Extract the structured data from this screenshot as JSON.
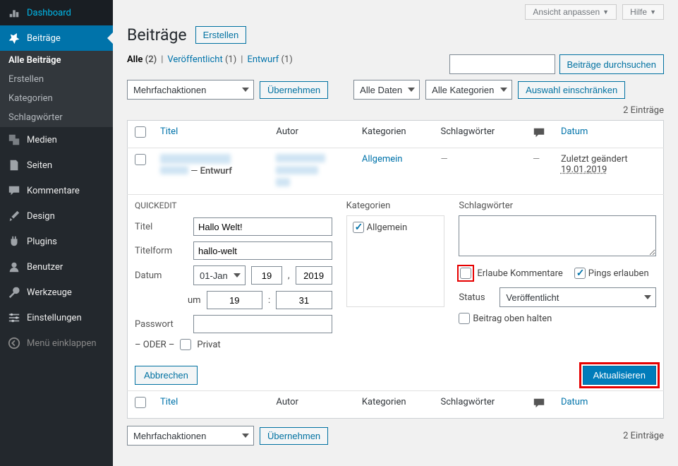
{
  "sidebar": {
    "items": [
      {
        "label": "Dashboard",
        "icon": "dashboard"
      },
      {
        "label": "Beiträge",
        "icon": "pin"
      },
      {
        "label": "Medien",
        "icon": "media"
      },
      {
        "label": "Seiten",
        "icon": "pages"
      },
      {
        "label": "Kommentare",
        "icon": "comments"
      },
      {
        "label": "Design",
        "icon": "brush"
      },
      {
        "label": "Plugins",
        "icon": "plug"
      },
      {
        "label": "Benutzer",
        "icon": "users"
      },
      {
        "label": "Werkzeuge",
        "icon": "tools"
      },
      {
        "label": "Einstellungen",
        "icon": "settings"
      },
      {
        "label": "Menü einklappen",
        "icon": "collapse"
      }
    ],
    "submenu": [
      "Alle Beiträge",
      "Erstellen",
      "Kategorien",
      "Schlagwörter"
    ]
  },
  "screen": {
    "customize": "Ansicht anpassen",
    "help": "Hilfe"
  },
  "heading": "Beiträge",
  "add_new": "Erstellen",
  "filters": {
    "all": "Alle",
    "all_count": "(2)",
    "published": "Veröffentlicht",
    "published_count": "(1)",
    "draft": "Entwurf",
    "draft_count": "(1)"
  },
  "search_btn": "Beiträge durchsuchen",
  "bulk_action": "Mehrfachaktionen",
  "apply": "Übernehmen",
  "all_dates": "Alle Daten",
  "all_cats": "Alle Kategorien",
  "filter_btn": "Auswahl einschränken",
  "item_count": "2 Einträge",
  "cols": {
    "title": "Titel",
    "author": "Autor",
    "cats": "Kategorien",
    "tags": "Schlagwörter",
    "date": "Datum"
  },
  "row1": {
    "state_sep": " — ",
    "state": "Entwurf",
    "cat": "Allgemein",
    "tags": "—",
    "comments": "—",
    "date_prefix": "Zuletzt geändert",
    "date": "19.01.2019"
  },
  "quickedit": {
    "label": "QUICKEDIT",
    "title_lbl": "Titel",
    "title_val": "Hallo Welt!",
    "slug_lbl": "Titelform",
    "slug_val": "hallo-welt",
    "date_lbl": "Datum",
    "month": "01-Jan",
    "day": "19",
    "year": "2019",
    "at": "um",
    "hour": "19",
    "sep": ":",
    "min": "31",
    "pass_lbl": "Passwort",
    "or": "– ODER –",
    "private": "Privat",
    "cats_lbl": "Kategorien",
    "cat_allgemein": "Allgemein",
    "tags_lbl": "Schlagwörter",
    "allow_comments": "Erlaube Kommentare",
    "allow_pings": "Pings erlauben",
    "status_lbl": "Status",
    "status_val": "Veröffentlicht",
    "sticky": "Beitrag oben halten",
    "cancel": "Abbrechen",
    "update": "Aktualisieren"
  }
}
